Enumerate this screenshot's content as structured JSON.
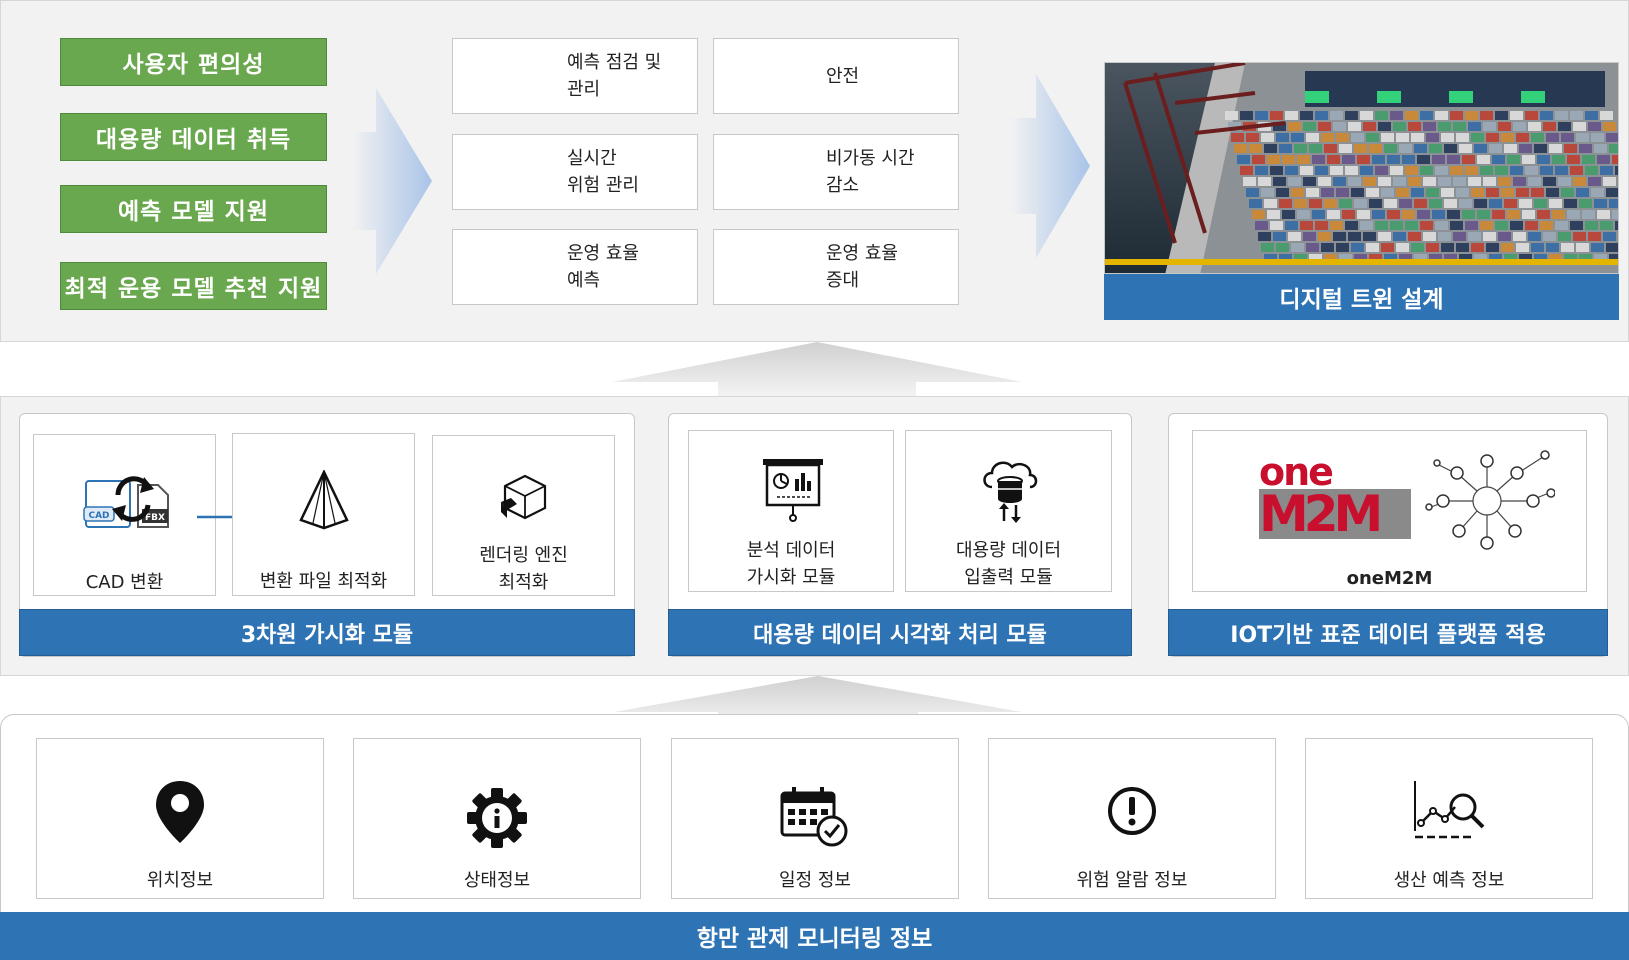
{
  "top": {
    "features": [
      "사용자 편의성",
      "대용량 데이터 취득",
      "예측 모델 지원",
      "최적 운용 모델 추천 지원"
    ],
    "benefits": [
      {
        "text": "예측 점검 및\n관리"
      },
      {
        "text": "안전"
      },
      {
        "text": "실시간\n위험 관리"
      },
      {
        "text": "비가동 시간\n감소"
      },
      {
        "text": "운영 효율\n예측"
      },
      {
        "text": "운영 효율\n증대"
      }
    ],
    "twin_label": "디지털 트윈 설계"
  },
  "middle": {
    "group1": {
      "cells": [
        "CAD 변환",
        "변환 파일 최적화",
        "렌더링 엔진\n최적화"
      ],
      "title": "3차원 가시화 모듈",
      "cad_tag": "CAD",
      "fbx_tag": "FBX"
    },
    "group2": {
      "cells": [
        "분석 데이터\n가시화 모듈",
        "대용량 데이터\n입출력 모듈"
      ],
      "title": "대용량 데이터 시각화 처리 모듈"
    },
    "group3": {
      "cell": "oneM2M",
      "logo_top": "one",
      "logo_bottom": "M2M",
      "title": "IOT기반 표준 데이터 플랫폼 적용"
    }
  },
  "bottom": {
    "items": [
      "위치정보",
      "상태정보",
      "일정 정보",
      "위험 알람 정보",
      "생산 예측 정보"
    ],
    "title": "항만 관제 모니터링 정보"
  },
  "colors": {
    "green": "#6aa84f",
    "blue": "#2e74b5",
    "onem2m_red": "#c8102e",
    "onem2m_gray": "#8a8a8a"
  }
}
